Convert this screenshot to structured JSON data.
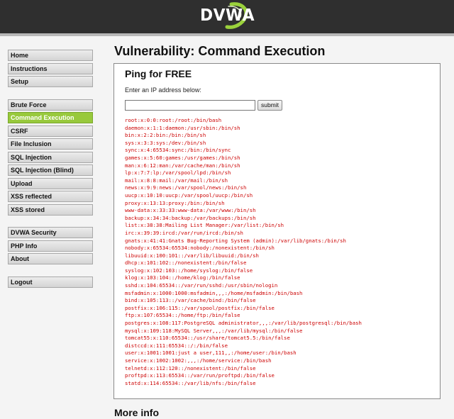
{
  "header": {
    "logo_text": "DVWA"
  },
  "menu": {
    "group1": [
      "Home",
      "Instructions",
      "Setup"
    ],
    "group2": [
      "Brute Force",
      "Command Execution",
      "CSRF",
      "File Inclusion",
      "SQL Injection",
      "SQL Injection (Blind)",
      "Upload",
      "XSS reflected",
      "XSS stored"
    ],
    "group3": [
      "DVWA Security",
      "PHP Info",
      "About"
    ],
    "group4": [
      "Logout"
    ],
    "selected": "Command Execution"
  },
  "main": {
    "title": "Vulnerability: Command Execution",
    "box_heading": "Ping for FREE",
    "ip_label": "Enter an IP address below:",
    "ip_value": "",
    "submit_label": "submit",
    "output_lines": [
      "root:x:0:0:root:/root:/bin/bash",
      "daemon:x:1:1:daemon:/usr/sbin:/bin/sh",
      "bin:x:2:2:bin:/bin:/bin/sh",
      "sys:x:3:3:sys:/dev:/bin/sh",
      "sync:x:4:65534:sync:/bin:/bin/sync",
      "games:x:5:60:games:/usr/games:/bin/sh",
      "man:x:6:12:man:/var/cache/man:/bin/sh",
      "lp:x:7:7:lp:/var/spool/lpd:/bin/sh",
      "mail:x:8:8:mail:/var/mail:/bin/sh",
      "news:x:9:9:news:/var/spool/news:/bin/sh",
      "uucp:x:10:10:uucp:/var/spool/uucp:/bin/sh",
      "proxy:x:13:13:proxy:/bin:/bin/sh",
      "www-data:x:33:33:www-data:/var/www:/bin/sh",
      "backup:x:34:34:backup:/var/backups:/bin/sh",
      "list:x:38:38:Mailing List Manager:/var/list:/bin/sh",
      "irc:x:39:39:ircd:/var/run/ircd:/bin/sh",
      "gnats:x:41:41:Gnats Bug-Reporting System (admin):/var/lib/gnats:/bin/sh",
      "nobody:x:65534:65534:nobody:/nonexistent:/bin/sh",
      "libuuid:x:100:101::/var/lib/libuuid:/bin/sh",
      "dhcp:x:101:102::/nonexistent:/bin/false",
      "syslog:x:102:103::/home/syslog:/bin/false",
      "klog:x:103:104::/home/klog:/bin/false",
      "sshd:x:104:65534::/var/run/sshd:/usr/sbin/nologin",
      "msfadmin:x:1000:1000:msfadmin,,,:/home/msfadmin:/bin/bash",
      "bind:x:105:113::/var/cache/bind:/bin/false",
      "postfix:x:106:115::/var/spool/postfix:/bin/false",
      "ftp:x:107:65534::/home/ftp:/bin/false",
      "postgres:x:108:117:PostgreSQL administrator,,,:/var/lib/postgresql:/bin/bash",
      "mysql:x:109:118:MySQL Server,,,:/var/lib/mysql:/bin/false",
      "tomcat55:x:110:65534::/usr/share/tomcat5.5:/bin/false",
      "distccd:x:111:65534::/:/bin/false",
      "user:x:1001:1001:just a user,111,,:/home/user:/bin/bash",
      "service:x:1002:1002:,,,:/home/service:/bin/bash",
      "telnetd:x:112:120::/nonexistent:/bin/false",
      "proftpd:x:113:65534::/var/run/proftpd:/bin/false",
      "statd:x:114:65534::/var/lib/nfs:/bin/false"
    ],
    "more_info_heading": "More info"
  },
  "colors": {
    "header_bg": "#2f2f2f",
    "menu_selected": "#98c93c",
    "output_text": "#cc0000"
  }
}
